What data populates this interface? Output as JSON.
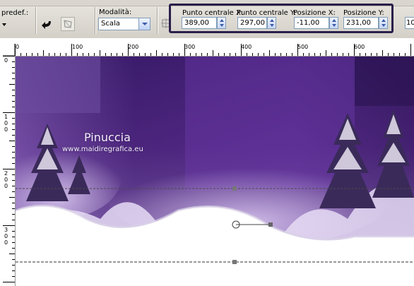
{
  "toolbar": {
    "preset_label": "predef.:",
    "mode_label": "Modalità:",
    "mode_value": "Scala",
    "center_x_label": "Punto centrale X:",
    "center_x_value": "389,00",
    "center_y_label": "Punto centrale Y:",
    "center_y_value": "297,00",
    "pos_x_label": "Posizione X:",
    "pos_x_value": "-11,00",
    "pos_y_label": "Posizione Y:",
    "pos_y_value": "231,00",
    "extra_value": "10",
    "highlight_color": "#2a1f4a"
  },
  "rulers": {
    "horizontal": [
      "0",
      "100",
      "200",
      "300",
      "400",
      "500",
      "600"
    ],
    "vertical": [
      "0",
      "100",
      "200",
      "300"
    ]
  },
  "image": {
    "watermark_name": "Pinuccia",
    "watermark_url": "www.maidiregrafica.eu",
    "sky_color": "#5a2d8c",
    "snow_color": "#ffffff"
  }
}
